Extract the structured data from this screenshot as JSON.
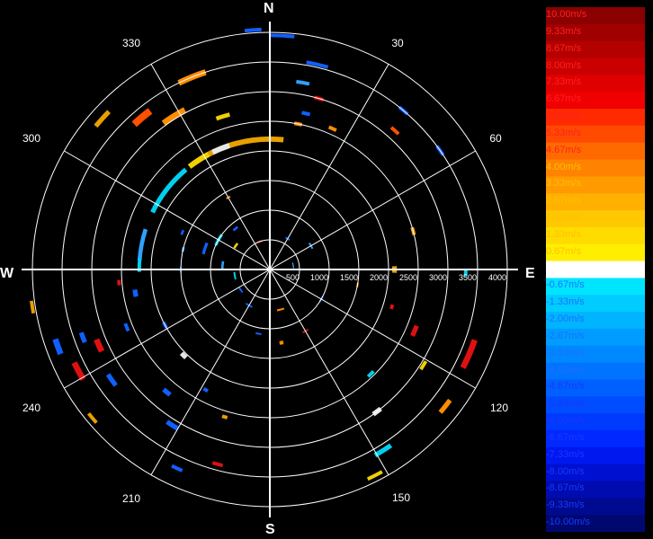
{
  "compass": {
    "north": "N",
    "south": "S",
    "east": "E",
    "west": "W"
  },
  "bearing_labels": [
    "30",
    "60",
    "120",
    "150",
    "210",
    "240",
    "300",
    "330"
  ],
  "range_labels": [
    "500",
    "1000",
    "1500",
    "2000",
    "2500",
    "3000",
    "3500",
    "4000"
  ],
  "colorbar": {
    "labels": [
      "10.00m/s",
      "9.33m/s",
      "8.67m/s",
      "8.00m/s",
      "7.33m/s",
      "6.67m/s",
      "6.00m/s",
      "5.33m/s",
      "4.67m/s",
      "4.00m/s",
      "3.33m/s",
      "2.67m/s",
      "2.00m/s",
      "1.33m/s",
      "0.67m/s",
      "0.00m/s",
      "-0.67m/s",
      "-1.33m/s",
      "-2.00m/s",
      "-2.67m/s",
      "-3.33m/s",
      "-4.00m/s",
      "-4.67m/s",
      "-5.33m/s",
      "-6.00m/s",
      "-6.67m/s",
      "-7.33m/s",
      "-8.00m/s",
      "-8.67m/s",
      "-9.33m/s",
      "-10.00m/s"
    ],
    "colors": [
      "#8b0000",
      "#a00000",
      "#b50000",
      "#ca0000",
      "#e00000",
      "#f00000",
      "#ff2a00",
      "#ff4a00",
      "#ff6a00",
      "#ff8200",
      "#ff9a00",
      "#ffb000",
      "#ffc800",
      "#ffdc00",
      "#ffee00",
      "#ffffff",
      "#00e5ff",
      "#00ccff",
      "#00b4ff",
      "#009cff",
      "#0088ff",
      "#0074ff",
      "#0060ff",
      "#004cff",
      "#003aff",
      "#0028ff",
      "#0018f0",
      "#0010d0",
      "#000cb0",
      "#000a90",
      "#000870"
    ]
  },
  "echo_colors": {
    "dark_red": "#b00000",
    "red": "#e01010",
    "orange_red": "#ff5000",
    "orange": "#ff8c00",
    "amber": "#e8a000",
    "yellow": "#f0d000",
    "white": "#e8e8e8",
    "cyan": "#00d0f0",
    "light_blue": "#30a0ff",
    "blue": "#1060ff",
    "deep_blue": "#0020d0"
  },
  "echoes": [
    {
      "az": -22,
      "r": 3500,
      "span": 8,
      "thick": 10,
      "color": "orange"
    },
    {
      "az": -40,
      "r": 3350,
      "span": 6,
      "thick": 12,
      "color": "orange_red"
    },
    {
      "az": -48,
      "r": 3800,
      "span": 5,
      "thick": 8,
      "color": "amber"
    },
    {
      "az": -32,
      "r": 3050,
      "span": 8,
      "thick": 10,
      "color": "orange"
    },
    {
      "az": -17,
      "r": 2700,
      "span": 5,
      "thick": 7,
      "color": "yellow"
    },
    {
      "az": -15,
      "r": 2200,
      "span": 42,
      "thick": 9,
      "color": "amber"
    },
    {
      "az": -22,
      "r": 2200,
      "span": 8,
      "thick": 9,
      "color": "white"
    },
    {
      "az": -33,
      "r": 2200,
      "span": 10,
      "thick": 9,
      "color": "yellow"
    },
    {
      "az": -52,
      "r": 2200,
      "span": 24,
      "thick": 8,
      "color": "cyan"
    },
    {
      "az": -79,
      "r": 2200,
      "span": 14,
      "thick": 7,
      "color": "light_blue"
    },
    {
      "az": -88,
      "r": 2200,
      "span": 6,
      "thick": 6,
      "color": "cyan"
    },
    {
      "az": 13,
      "r": 3550,
      "span": 6,
      "thick": 6,
      "color": "blue"
    },
    {
      "az": 3,
      "r": 3950,
      "span": 6,
      "thick": 6,
      "color": "blue"
    },
    {
      "az": -4,
      "r": 4050,
      "span": 4,
      "thick": 6,
      "color": "blue"
    },
    {
      "az": 10,
      "r": 3200,
      "span": 4,
      "thick": 6,
      "color": "light_blue"
    },
    {
      "az": 16,
      "r": 3000,
      "span": 3,
      "thick": 6,
      "color": "red"
    },
    {
      "az": 24,
      "r": 2600,
      "span": 3,
      "thick": 6,
      "color": "orange"
    },
    {
      "az": 13,
      "r": 2700,
      "span": 3,
      "thick": 6,
      "color": "blue"
    },
    {
      "az": 11,
      "r": 2500,
      "span": 3,
      "thick": 6,
      "color": "orange"
    },
    {
      "az": 42,
      "r": 3150,
      "span": 3,
      "thick": 6,
      "color": "orange_red"
    },
    {
      "az": 40,
      "r": 3500,
      "span": 3,
      "thick": 6,
      "color": "blue"
    },
    {
      "az": 55,
      "r": 3500,
      "span": 3,
      "thick": 6,
      "color": "blue"
    },
    {
      "az": 75,
      "r": 2500,
      "span": 3,
      "thick": 6,
      "color": "amber"
    },
    {
      "az": 90,
      "r": 2100,
      "span": 3,
      "thick": 8,
      "color": "amber"
    },
    {
      "az": 91,
      "r": 3300,
      "span": 2,
      "thick": 6,
      "color": "cyan"
    },
    {
      "az": 107,
      "r": 2150,
      "span": 2,
      "thick": 6,
      "color": "red"
    },
    {
      "az": 113,
      "r": 2650,
      "span": 4,
      "thick": 8,
      "color": "red"
    },
    {
      "az": 113,
      "r": 3650,
      "span": 8,
      "thick": 10,
      "color": "red"
    },
    {
      "az": 122,
      "r": 3050,
      "span": 3,
      "thick": 6,
      "color": "yellow"
    },
    {
      "az": 128,
      "r": 3750,
      "span": 4,
      "thick": 8,
      "color": "orange"
    },
    {
      "az": 136,
      "r": 2450,
      "span": 3,
      "thick": 6,
      "color": "cyan"
    },
    {
      "az": 143,
      "r": 3000,
      "span": 3,
      "thick": 8,
      "color": "white"
    },
    {
      "az": 148,
      "r": 3600,
      "span": 5,
      "thick": 8,
      "color": "cyan"
    },
    {
      "az": 153,
      "r": 3900,
      "span": 4,
      "thick": 6,
      "color": "yellow"
    },
    {
      "az": 171,
      "r": 1250,
      "span": 3,
      "thick": 6,
      "color": "orange"
    },
    {
      "az": -99,
      "r": 4050,
      "span": 3,
      "thick": 6,
      "color": "amber"
    },
    {
      "az": -110,
      "r": 3350,
      "span": 3,
      "thick": 8,
      "color": "blue"
    },
    {
      "az": -110,
      "r": 3800,
      "span": 4,
      "thick": 10,
      "color": "blue"
    },
    {
      "az": -114,
      "r": 3150,
      "span": 4,
      "thick": 10,
      "color": "red"
    },
    {
      "az": -118,
      "r": 3650,
      "span": 5,
      "thick": 10,
      "color": "red"
    },
    {
      "az": -112,
      "r": 2600,
      "span": 3,
      "thick": 6,
      "color": "blue"
    },
    {
      "az": -125,
      "r": 3250,
      "span": 4,
      "thick": 8,
      "color": "blue"
    },
    {
      "az": -130,
      "r": 3900,
      "span": 3,
      "thick": 6,
      "color": "amber"
    },
    {
      "az": -135,
      "r": 2050,
      "span": 3,
      "thick": 8,
      "color": "white"
    },
    {
      "az": -140,
      "r": 2700,
      "span": 3,
      "thick": 8,
      "color": "blue"
    },
    {
      "az": -148,
      "r": 3100,
      "span": 4,
      "thick": 8,
      "color": "blue"
    },
    {
      "az": -155,
      "r": 3700,
      "span": 3,
      "thick": 6,
      "color": "blue"
    },
    {
      "az": -165,
      "r": 3400,
      "span": 3,
      "thick": 6,
      "color": "red"
    },
    {
      "az": -163,
      "r": 2600,
      "span": 2,
      "thick": 6,
      "color": "amber"
    },
    {
      "az": -152,
      "r": 2300,
      "span": 2,
      "thick": 6,
      "color": "blue"
    },
    {
      "az": -100,
      "r": 2300,
      "span": 3,
      "thick": 8,
      "color": "blue"
    },
    {
      "az": -95,
      "r": 2550,
      "span": 2,
      "thick": 6,
      "color": "red"
    },
    {
      "az": -118,
      "r": 2000,
      "span": 3,
      "thick": 6,
      "color": "blue"
    },
    {
      "az": -72,
      "r": 1150,
      "span": 10,
      "thick": 5,
      "color": "blue"
    },
    {
      "az": -60,
      "r": 1000,
      "span": 12,
      "thick": 5,
      "color": "cyan"
    },
    {
      "az": -85,
      "r": 800,
      "span": 10,
      "thick": 4,
      "color": "light_blue"
    },
    {
      "az": -55,
      "r": 700,
      "span": 8,
      "thick": 4,
      "color": "yellow"
    },
    {
      "az": -40,
      "r": 900,
      "span": 6,
      "thick": 4,
      "color": "blue"
    },
    {
      "az": -100,
      "r": 600,
      "span": 12,
      "thick": 3,
      "color": "cyan"
    },
    {
      "az": -125,
      "r": 600,
      "span": 10,
      "thick": 3,
      "color": "blue"
    },
    {
      "az": -150,
      "r": 700,
      "span": 10,
      "thick": 3,
      "color": "blue"
    },
    {
      "az": 165,
      "r": 700,
      "span": 10,
      "thick": 3,
      "color": "orange"
    },
    {
      "az": 150,
      "r": 1200,
      "span": 5,
      "thick": 3,
      "color": "red"
    },
    {
      "az": 120,
      "r": 1000,
      "span": 6,
      "thick": 3,
      "color": "blue"
    },
    {
      "az": 60,
      "r": 800,
      "span": 8,
      "thick": 3,
      "color": "light_blue"
    },
    {
      "az": 30,
      "r": 600,
      "span": 8,
      "thick": 3,
      "color": "blue"
    },
    {
      "az": -20,
      "r": 500,
      "span": 10,
      "thick": 3,
      "color": "red"
    },
    {
      "az": 80,
      "r": 400,
      "span": 14,
      "thick": 2,
      "color": "light_blue"
    },
    {
      "az": -170,
      "r": 1100,
      "span": 5,
      "thick": 3,
      "color": "blue"
    },
    {
      "az": 100,
      "r": 1500,
      "span": 3,
      "thick": 3,
      "color": "orange"
    },
    {
      "az": -30,
      "r": 1400,
      "span": 3,
      "thick": 3,
      "color": "orange"
    },
    {
      "az": -77,
      "r": 1500,
      "span": 3,
      "thick": 4,
      "color": "light_blue"
    },
    {
      "az": -67,
      "r": 1600,
      "span": 3,
      "thick": 4,
      "color": "blue"
    },
    {
      "az": -90,
      "r": 1500,
      "span": 4,
      "thick": 3,
      "color": "blue"
    }
  ]
}
